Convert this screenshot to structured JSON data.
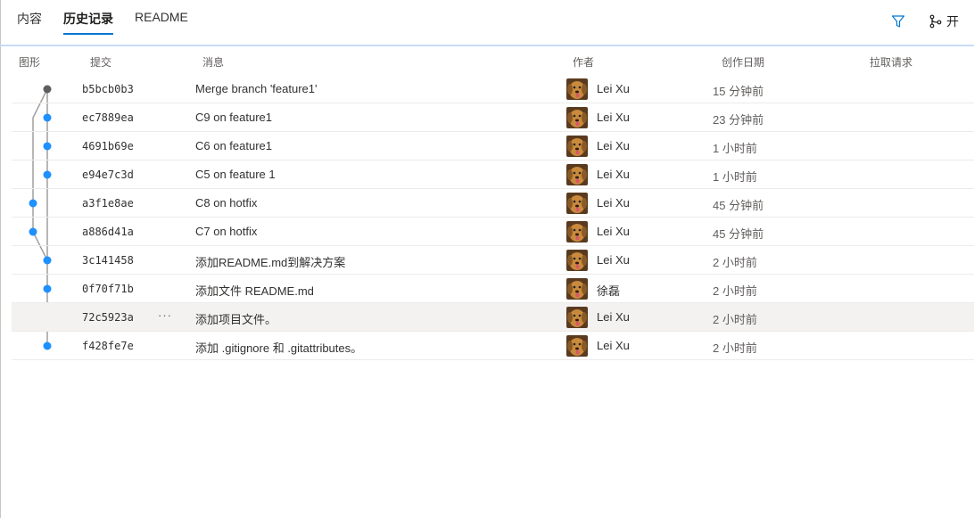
{
  "tabs": {
    "contents": "内容",
    "history": "历史记录",
    "readme": "README"
  },
  "toolbar": {
    "filter_icon": "filter-icon",
    "branch_icon": "branch-icon",
    "branch_label": "开"
  },
  "columns": {
    "graph": "图形",
    "commit": "提交",
    "message": "消息",
    "author": "作者",
    "date": "创作日期",
    "pr": "拉取请求"
  },
  "colors": {
    "accent": "#0078d4",
    "graph_line": "#a19f9d",
    "node_blue": "#1e90ff",
    "node_merge": "#605e5c"
  },
  "commits": [
    {
      "hash": "b5bcb0b3",
      "message": "Merge branch 'feature1'",
      "author": "Lei Xu",
      "date": "15 分钟前"
    },
    {
      "hash": "ec7889ea",
      "message": "C9 on feature1",
      "author": "Lei Xu",
      "date": "23 分钟前"
    },
    {
      "hash": "4691b69e",
      "message": "C6 on feature1",
      "author": "Lei Xu",
      "date": "1 小时前"
    },
    {
      "hash": "e94e7c3d",
      "message": "C5 on feature 1",
      "author": "Lei Xu",
      "date": "1 小时前"
    },
    {
      "hash": "a3f1e8ae",
      "message": "C8 on hotfix",
      "author": "Lei Xu",
      "date": "45 分钟前"
    },
    {
      "hash": "a886d41a",
      "message": "C7 on hotfix",
      "author": "Lei Xu",
      "date": "45 分钟前"
    },
    {
      "hash": "3c141458",
      "message": "添加README.md到解决方案",
      "author": "Lei Xu",
      "date": "2 小时前"
    },
    {
      "hash": "0f70f71b",
      "message": "添加文件 README.md",
      "author": "徐磊",
      "date": "2 小时前"
    },
    {
      "hash": "72c5923a",
      "message": "添加项目文件。",
      "author": "Lei Xu",
      "date": "2 小时前",
      "more": "···"
    },
    {
      "hash": "f428fe7e",
      "message": "添加 .gitignore 和 .gitattributes。",
      "author": "Lei Xu",
      "date": "2 小时前"
    }
  ]
}
